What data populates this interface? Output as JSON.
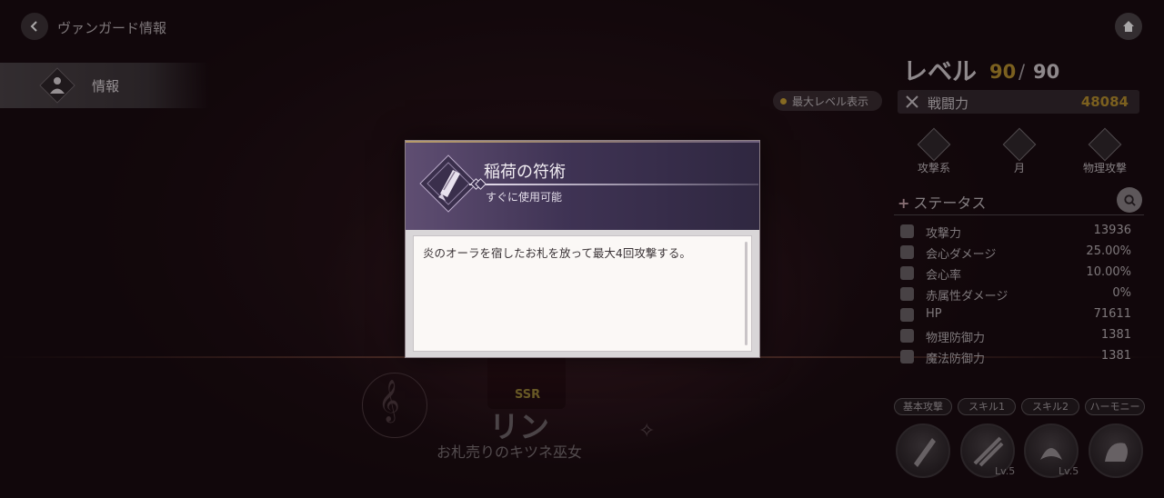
{
  "header": {
    "title": "ヴァンガード情報",
    "back_icon": "back-arrow-icon",
    "home_icon": "home-icon"
  },
  "sidebar": {
    "items": [
      {
        "label": "情報",
        "icon": "person-icon",
        "active": true
      }
    ]
  },
  "level": {
    "label": "レベル",
    "current": "90",
    "separator": "/",
    "max": "90"
  },
  "max_level_button": {
    "label": "最大レベル表示"
  },
  "power": {
    "label": "戦闘力",
    "value": "48084"
  },
  "attributes": [
    {
      "label": "攻撃系",
      "icon": "sword-icon"
    },
    {
      "label": "月",
      "icon": "eye-icon"
    },
    {
      "label": "物理攻撃",
      "icon": "fist-icon"
    }
  ],
  "status": {
    "title": "ステータス",
    "plus": "+",
    "stats": [
      {
        "name": "攻撃力",
        "value": "13936",
        "icon": "fist-icon"
      },
      {
        "name": "会心ダメージ",
        "value": "25.00%",
        "icon": "burst-icon"
      },
      {
        "name": "会心率",
        "value": "10.00%",
        "icon": "crit-icon"
      },
      {
        "name": "赤属性ダメージ",
        "value": "0%",
        "icon": "blade-icon"
      },
      {
        "name": "HP",
        "value": "71611",
        "icon": "heart-icon"
      },
      {
        "name": "物理防御力",
        "value": "1381",
        "icon": "shield-icon"
      },
      {
        "name": "魔法防御力",
        "value": "1381",
        "icon": "magic-shield-icon"
      }
    ]
  },
  "skill_tabs": [
    "基本攻撃",
    "スキル1",
    "スキル2",
    "ハーモニー"
  ],
  "skill_levels": [
    "Lv.5",
    "Lv.5"
  ],
  "character": {
    "rarity": "SSR",
    "name": "リン",
    "title": "お札売りのキツネ巫女"
  },
  "dialog": {
    "title": "稲荷の符術",
    "subtitle": "すぐに使用可能",
    "description": "炎のオーラを宿したお札を放って最大4回攻撃する。"
  },
  "colors": {
    "gold": "#b8922d",
    "dialog_header": "#3f3354"
  }
}
